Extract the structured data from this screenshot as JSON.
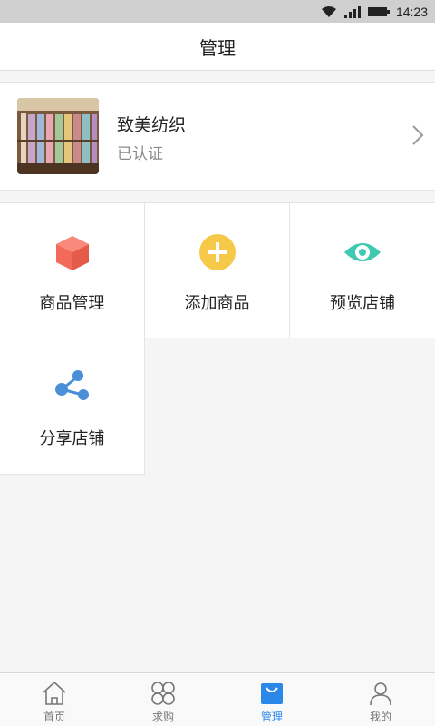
{
  "status_bar": {
    "time": "14:23",
    "icons": [
      "wifi-icon",
      "signal-icon",
      "battery-icon"
    ]
  },
  "header": {
    "title": "管理"
  },
  "store": {
    "name": "致美纺织",
    "status": "已认证"
  },
  "actions": [
    {
      "label": "商品管理",
      "icon": "box-icon",
      "color": "#f26b5a"
    },
    {
      "label": "添加商品",
      "icon": "plus-circle-icon",
      "color": "#f7c948"
    },
    {
      "label": "预览店铺",
      "icon": "eye-icon",
      "color": "#3ec9b0"
    },
    {
      "label": "分享店铺",
      "icon": "share-icon",
      "color": "#4a90d9"
    }
  ],
  "tabs": [
    {
      "label": "首页",
      "icon": "home-icon",
      "active": false
    },
    {
      "label": "求购",
      "icon": "grid-icon",
      "active": false
    },
    {
      "label": "管理",
      "icon": "bag-icon",
      "active": true
    },
    {
      "label": "我的",
      "icon": "user-icon",
      "active": false
    }
  ],
  "colors": {
    "accent": "#2b88e8"
  }
}
